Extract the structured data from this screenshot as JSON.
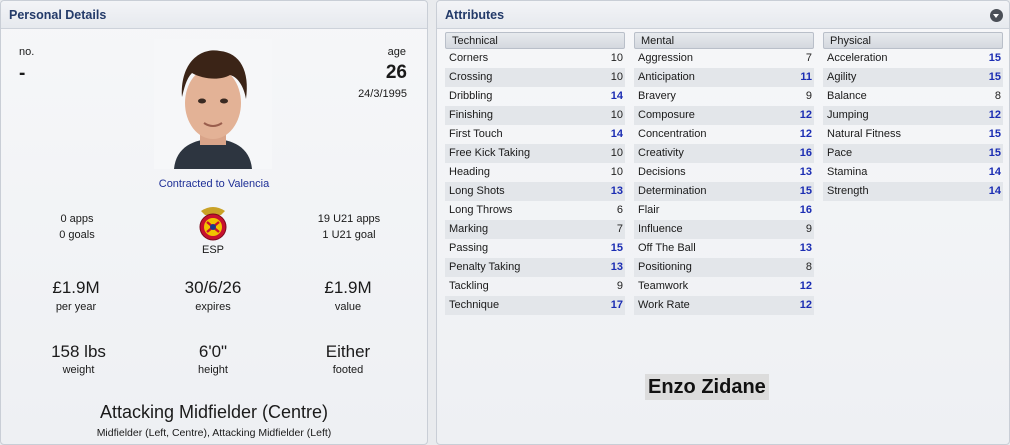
{
  "personal": {
    "title": "Personal Details",
    "no_label": "no.",
    "no_value": "-",
    "age_label": "age",
    "age_value": "26",
    "dob": "24/3/1995",
    "contract": "Contracted to Valencia",
    "apps": "0 apps",
    "goals": "0 goals",
    "nation": "ESP",
    "u21_apps": "19 U21 apps",
    "u21_goals": "1 U21 goal",
    "wage": "£1.9M",
    "wage_label": "per year",
    "expires": "30/6/26",
    "expires_label": "expires",
    "value": "£1.9M",
    "value_label": "value",
    "weight": "158 lbs",
    "weight_label": "weight",
    "height": "6'0\"",
    "height_label": "height",
    "foot": "Either",
    "foot_label": "footed",
    "position": "Attacking Midfielder (Centre)",
    "positions_other": "Midfielder (Left, Centre), Attacking Midfielder (Left)"
  },
  "attributes": {
    "title": "Attributes",
    "technical": {
      "label": "Technical",
      "items": [
        {
          "name": "Corners",
          "value": "10"
        },
        {
          "name": "Crossing",
          "value": "10"
        },
        {
          "name": "Dribbling",
          "value": "14"
        },
        {
          "name": "Finishing",
          "value": "10"
        },
        {
          "name": "First Touch",
          "value": "14"
        },
        {
          "name": "Free Kick Taking",
          "value": "10"
        },
        {
          "name": "Heading",
          "value": "10"
        },
        {
          "name": "Long Shots",
          "value": "13"
        },
        {
          "name": "Long Throws",
          "value": "6"
        },
        {
          "name": "Marking",
          "value": "7"
        },
        {
          "name": "Passing",
          "value": "15"
        },
        {
          "name": "Penalty Taking",
          "value": "13"
        },
        {
          "name": "Tackling",
          "value": "9"
        },
        {
          "name": "Technique",
          "value": "17"
        }
      ]
    },
    "mental": {
      "label": "Mental",
      "items": [
        {
          "name": "Aggression",
          "value": "7"
        },
        {
          "name": "Anticipation",
          "value": "11"
        },
        {
          "name": "Bravery",
          "value": "9"
        },
        {
          "name": "Composure",
          "value": "12"
        },
        {
          "name": "Concentration",
          "value": "12"
        },
        {
          "name": "Creativity",
          "value": "16"
        },
        {
          "name": "Decisions",
          "value": "13"
        },
        {
          "name": "Determination",
          "value": "15"
        },
        {
          "name": "Flair",
          "value": "16"
        },
        {
          "name": "Influence",
          "value": "9"
        },
        {
          "name": "Off The Ball",
          "value": "13"
        },
        {
          "name": "Positioning",
          "value": "8"
        },
        {
          "name": "Teamwork",
          "value": "12"
        },
        {
          "name": "Work Rate",
          "value": "12"
        }
      ]
    },
    "physical": {
      "label": "Physical",
      "items": [
        {
          "name": "Acceleration",
          "value": "15"
        },
        {
          "name": "Agility",
          "value": "15"
        },
        {
          "name": "Balance",
          "value": "8"
        },
        {
          "name": "Jumping",
          "value": "12"
        },
        {
          "name": "Natural Fitness",
          "value": "15"
        },
        {
          "name": "Pace",
          "value": "15"
        },
        {
          "name": "Stamina",
          "value": "14"
        },
        {
          "name": "Strength",
          "value": "14"
        }
      ]
    }
  },
  "player_name": "Enzo Zidane",
  "colors": {
    "header_text": "#233a69",
    "highlight_value": "#1b2db3",
    "contract_link": "#1e2f96"
  }
}
